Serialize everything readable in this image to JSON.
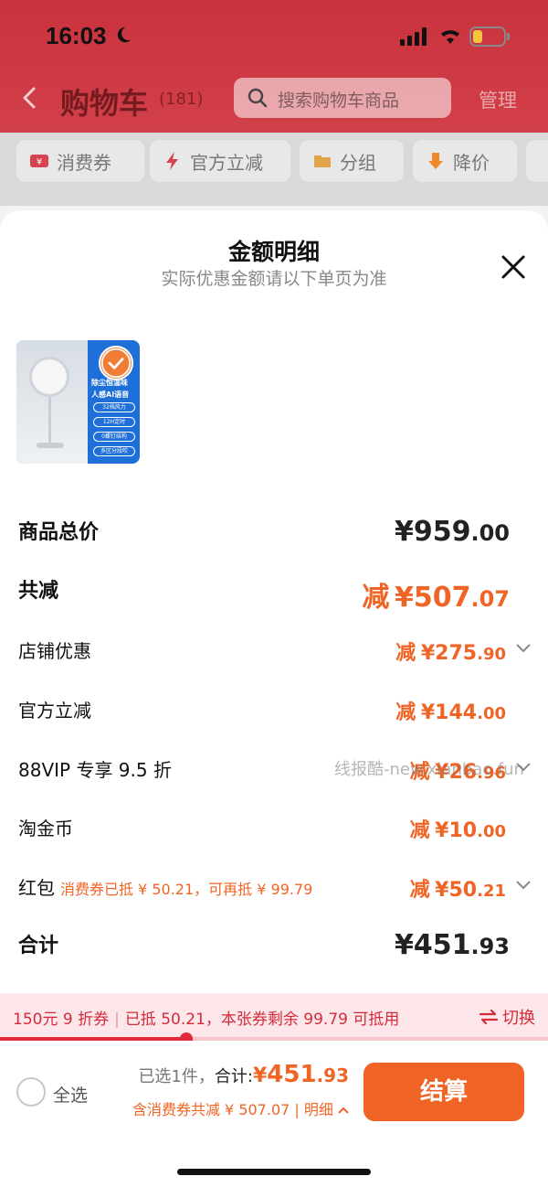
{
  "status_bar": {
    "time": "16:03"
  },
  "nav": {
    "title": "购物车",
    "count": "(181)",
    "search_placeholder": "搜索购物车商品",
    "manage": "管理"
  },
  "chips": [
    {
      "label": "消费券",
      "icon": "coupon-icon"
    },
    {
      "label": "官方立减",
      "icon": "lightning-icon"
    },
    {
      "label": "分组",
      "icon": "folder-icon"
    },
    {
      "label": "降价",
      "icon": "price-down-icon"
    }
  ],
  "sheet": {
    "title": "金额明细",
    "subtitle": "实际优惠金额请以下单页为准",
    "product_thumb": {
      "lines": [
        "除尘恒温味",
        "人感AI语音"
      ],
      "pills": [
        "32档风力",
        "12H定时",
        "0螺钉结构",
        "多区分段吹"
      ]
    },
    "rows": {
      "goods_total": {
        "label": "商品总价",
        "cur": "¥",
        "int": "959",
        "dec": ".00"
      },
      "total_off": {
        "label": "共减",
        "prefix": "减",
        "cur": "¥",
        "int": "507",
        "dec": ".07"
      },
      "shop_discount": {
        "label": "店铺优惠",
        "prefix": "减",
        "cur": "¥",
        "int": "275",
        "dec": ".90"
      },
      "official_off": {
        "label": "官方立减",
        "prefix": "减",
        "cur": "¥",
        "int": "144",
        "dec": ".00"
      },
      "vip": {
        "label": "88VIP 专享 9.5 折",
        "prefix": "减",
        "cur": "¥",
        "int": "26",
        "dec": ".96"
      },
      "coins": {
        "label": "淘金币",
        "prefix": "减",
        "cur": "¥",
        "int": "10",
        "dec": ".00"
      },
      "red_packet": {
        "label": "红包",
        "note": "消费券已抵 ¥ 50.21，可再抵 ¥ 99.79",
        "prefix": "减",
        "cur": "¥",
        "int": "50",
        "dec": ".21"
      },
      "total": {
        "label": "合计",
        "cur": "¥",
        "int": "451",
        "dec": ".93"
      }
    },
    "watermark": "线报酷-new.xianbao.fun"
  },
  "coupon_banner": {
    "name": "150元 9 折券",
    "used": "已抵 50.21，本张券剩余 99.79 可抵用",
    "switch": "切换",
    "progress_fraction": 0.34
  },
  "checkout": {
    "select_all": "全选",
    "selected_count": "已选1件，",
    "total_label": "合计:",
    "total_cur": "¥",
    "total_int": "451",
    "total_dec": ".93",
    "discount_note": "含消费券共减 ¥ 507.07",
    "sep": "|",
    "detail": "明细",
    "button": "结算"
  },
  "colors": {
    "accent": "#f06425",
    "header": "#c8323c",
    "banner_text": "#d42b3a"
  }
}
